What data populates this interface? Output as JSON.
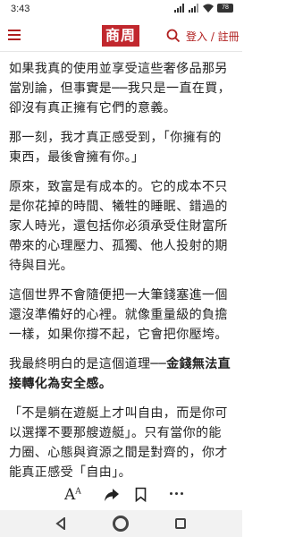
{
  "status_bar": {
    "time": "3:43",
    "battery": "78"
  },
  "header": {
    "brand": "商周",
    "login_label": "登入 / 註冊"
  },
  "article": {
    "paragraphs": [
      {
        "text": "如果我真的使用並享受這些奢侈品那另當別論，但事實是──我只是一直在買，卻沒有真正擁有它們的意義。"
      },
      {
        "text": "那一刻，我才真正感受到，「你擁有的東西，最後會擁有你。」"
      },
      {
        "text": "原來，致富是有成本的。它的成本不只是你花掉的時間、犧牲的睡眠、錯過的家人時光，還包括你必須承受住財富所帶來的心理壓力、孤獨、他人投射的期待與目光。"
      },
      {
        "text": "這個世界不會隨便把一大筆錢塞進一個還沒準備好的心裡。就像重量級的負擔一樣，如果你撐不起，它會把你壓垮。"
      },
      {
        "lead": "我最終明白的是這個道理──",
        "bold": "金錢無法直接轉化為安全感。"
      },
      {
        "text": "「不是躺在遊艇上才叫自由，而是你可以選擇不要那艘遊艇」。只有當你的能力圈、心態與資源之間是對齊的，你才能真正感受「自由」。"
      }
    ]
  },
  "toolbar": {
    "font_label": "A",
    "font_sup": "A"
  }
}
